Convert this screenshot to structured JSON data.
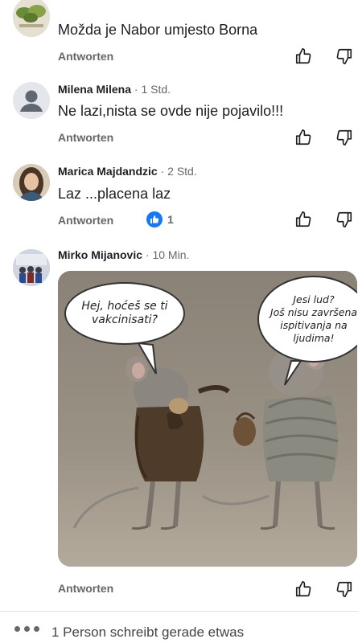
{
  "comments": [
    {
      "text": "Možda je Nabor umjesto Borna",
      "reply_label": "Antworten"
    },
    {
      "author": "Milena Milena",
      "time": "· 1 Std.",
      "text": "Ne lazi,nista se ovde nije pojavilo!!!",
      "reply_label": "Antworten"
    },
    {
      "author": "Marica Majdandzic",
      "time": "· 2 Std.",
      "text": "Laz ...placena laz",
      "reply_label": "Antworten",
      "reaction_count": "1"
    },
    {
      "author": "Mirko Mijanovic",
      "time": "· 10 Min.",
      "image": {
        "bubble_left": [
          "Hej, hoćeš se ti",
          "vakcinisati?"
        ],
        "bubble_right": [
          "Jesi lud?",
          "Još nisu završena",
          "ispitivanja na",
          "ljudima!"
        ]
      },
      "reply_label": "Antworten"
    }
  ],
  "typing": {
    "text": "1 Person schreibt gerade etwas"
  },
  "colors": {
    "reaction_blue": "#1877f2",
    "meta_gray": "#65676b"
  },
  "icons": [
    "thumbs-up-icon",
    "thumbs-down-icon",
    "like-reaction-icon",
    "default-avatar-icon",
    "typing-dots-icon"
  ]
}
